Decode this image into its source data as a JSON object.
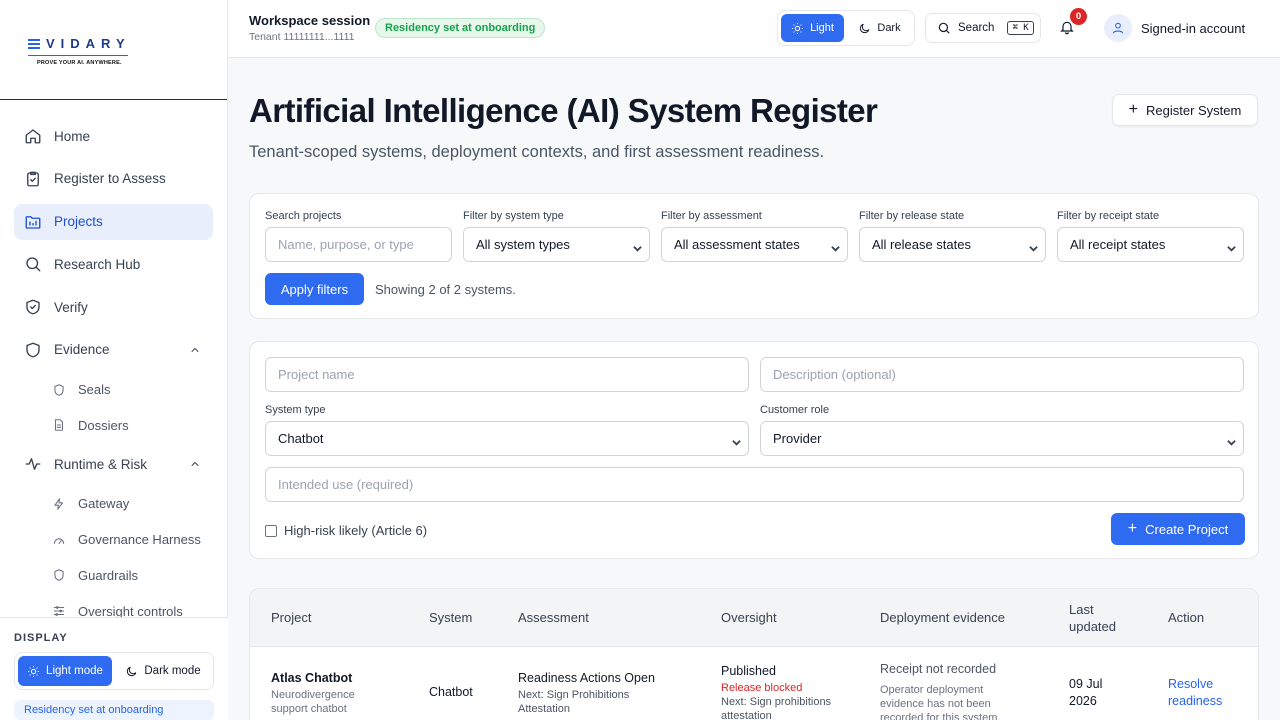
{
  "brand": {
    "name": "VIDARY",
    "tagline": "PROVE YOUR AI. ANYWHERE."
  },
  "sidebar": {
    "items": [
      {
        "label": "Home",
        "icon": "home-icon"
      },
      {
        "label": "Register to Assess",
        "icon": "clipboard-check-icon"
      },
      {
        "label": "Projects",
        "icon": "folder-icon",
        "active": true
      },
      {
        "label": "Research Hub",
        "icon": "search-icon"
      },
      {
        "label": "Verify",
        "icon": "shield-check-icon"
      },
      {
        "label": "Evidence",
        "icon": "shield-icon",
        "expanded": true
      },
      {
        "label": "Runtime & Risk",
        "icon": "activity-icon",
        "expanded": true
      }
    ],
    "evidence_children": [
      {
        "label": "Seals",
        "icon": "seal-icon"
      },
      {
        "label": "Dossiers",
        "icon": "document-icon"
      }
    ],
    "runtime_children": [
      {
        "label": "Gateway",
        "icon": "bolt-icon"
      },
      {
        "label": "Governance Harness",
        "icon": "gauge-icon"
      },
      {
        "label": "Guardrails",
        "icon": "shield-icon"
      },
      {
        "label": "Oversight controls",
        "icon": "sliders-icon"
      }
    ],
    "display": {
      "label": "DISPLAY",
      "light": "Light mode",
      "dark": "Dark mode",
      "selected": "light",
      "note": "Residency set at onboarding"
    }
  },
  "header": {
    "workspace_title": "Workspace session",
    "tenant": "Tenant 11111111...1111",
    "residency_badge": "Residency set at onboarding",
    "theme_light": "Light",
    "theme_dark": "Dark",
    "search_label": "Search",
    "search_shortcut": "⌘ K",
    "notification_count": "0",
    "account_label": "Signed-in account"
  },
  "page": {
    "title": "Artificial Intelligence (AI) System Register",
    "subtitle": "Tenant-scoped systems, deployment contexts, and first assessment readiness.",
    "register_button": "Register System"
  },
  "filters": {
    "search_label": "Search projects",
    "search_placeholder": "Name, purpose, or type",
    "system_type_label": "Filter by system type",
    "system_type_value": "All system types",
    "assessment_label": "Filter by assessment",
    "assessment_value": "All assessment states",
    "release_label": "Filter by release state",
    "release_value": "All release states",
    "receipt_label": "Filter by receipt state",
    "receipt_value": "All receipt states",
    "apply_label": "Apply filters",
    "showing_text": "Showing 2 of 2 systems."
  },
  "create_form": {
    "project_name_placeholder": "Project name",
    "description_placeholder": "Description (optional)",
    "system_type_label": "System type",
    "system_type_value": "Chatbot",
    "customer_role_label": "Customer role",
    "customer_role_value": "Provider",
    "intended_use_placeholder": "Intended use (required)",
    "high_risk_label": "High-risk likely (Article 6)",
    "create_label": "Create Project"
  },
  "table": {
    "headers": [
      "Project",
      "System",
      "Assessment",
      "Oversight",
      "Deployment evidence",
      "Last updated",
      "Action"
    ],
    "rows": [
      {
        "project": "Atlas Chatbot",
        "project_desc": "Neurodivergence support chatbot",
        "system": "Chatbot",
        "assessment": "Readiness Actions Open",
        "assessment_next": "Next: Sign Prohibitions Attestation",
        "oversight": "Published",
        "oversight_status": "Release blocked",
        "oversight_next": "Next: Sign prohibitions attestation",
        "evidence": "Receipt not recorded",
        "evidence_desc": "Operator deployment evidence has not been recorded for this system.",
        "updated": "09 Jul 2026",
        "action": "Resolve readiness"
      }
    ]
  }
}
